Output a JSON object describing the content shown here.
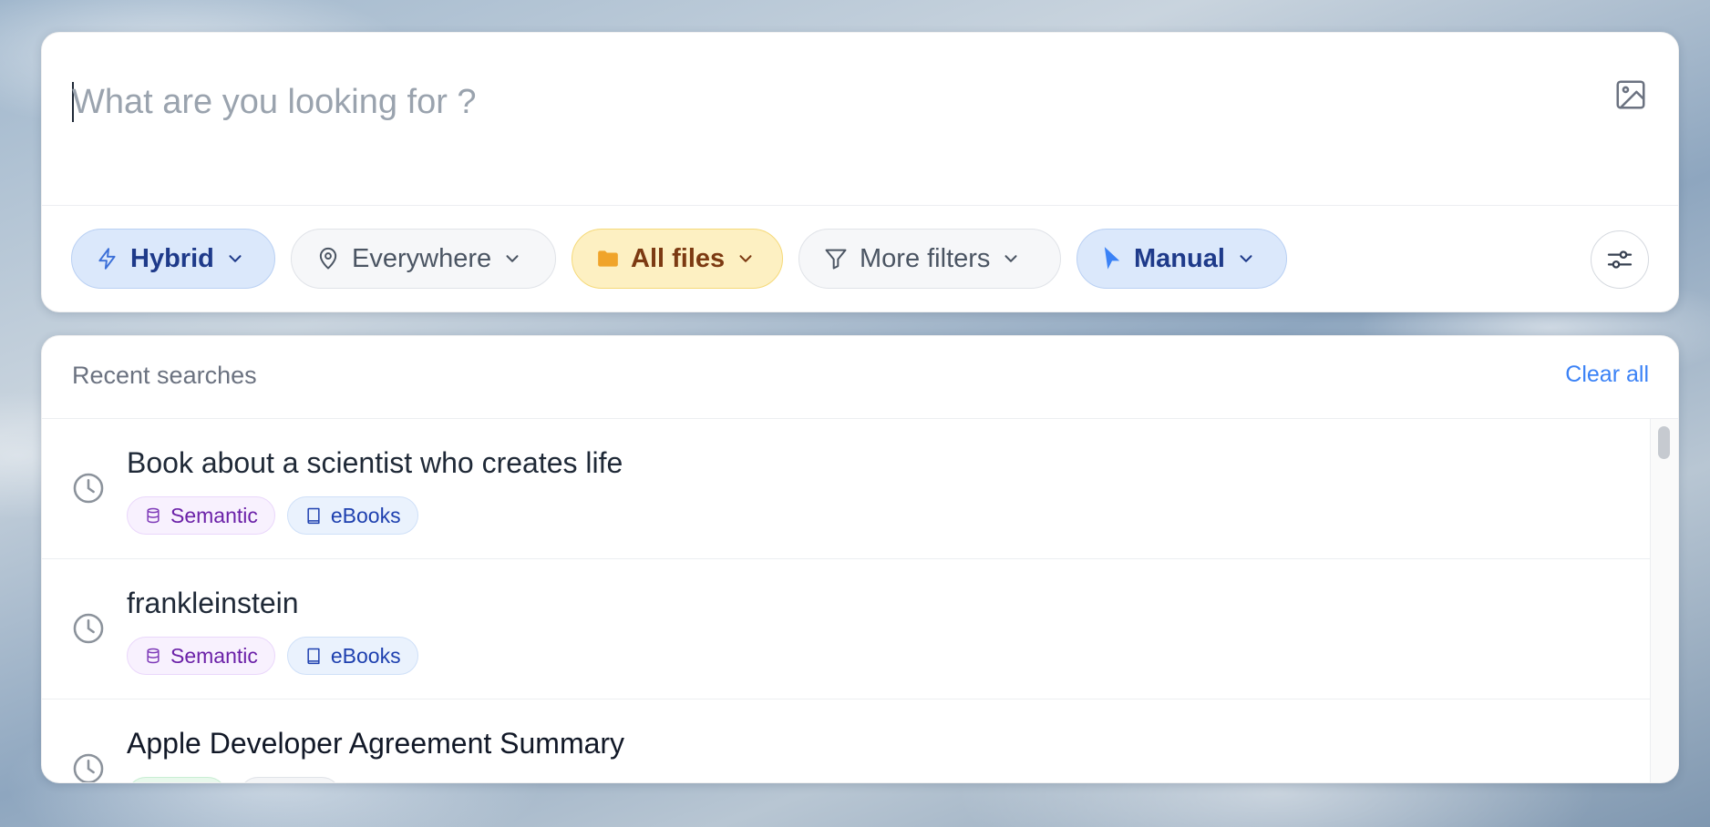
{
  "search": {
    "placeholder": "What are you looking for ?",
    "value": ""
  },
  "filters": {
    "mode": {
      "label": "Hybrid",
      "icon": "lightning-icon",
      "color": "#3b6fd8"
    },
    "location": {
      "label": "Everywhere",
      "icon": "map-pin-icon"
    },
    "file_type": {
      "label": "All files",
      "icon": "folder-icon",
      "color": "#f0a42a"
    },
    "more": {
      "label": "More filters",
      "icon": "filter-icon"
    },
    "trigger": {
      "label": "Manual",
      "icon": "cursor-icon",
      "color": "#3b82f6"
    }
  },
  "recent": {
    "title": "Recent searches",
    "clear_label": "Clear all",
    "items": [
      {
        "query": "Book about a scientist who creates life",
        "tags": [
          {
            "label": "Semantic",
            "icon": "database-icon"
          },
          {
            "label": "eBooks",
            "icon": "book-icon"
          }
        ]
      },
      {
        "query": "frankleinstein",
        "tags": [
          {
            "label": "Semantic",
            "icon": "database-icon"
          },
          {
            "label": "eBooks",
            "icon": "book-icon"
          }
        ]
      },
      {
        "query": "Apple Developer Agreement Summary",
        "tags": [
          {
            "label": "",
            "icon": ""
          },
          {
            "label": "",
            "icon": ""
          }
        ]
      }
    ]
  },
  "colors": {
    "accent": "#3b82f6",
    "semantic_tag": "#6b21a8",
    "ebooks_tag": "#1e40af"
  }
}
